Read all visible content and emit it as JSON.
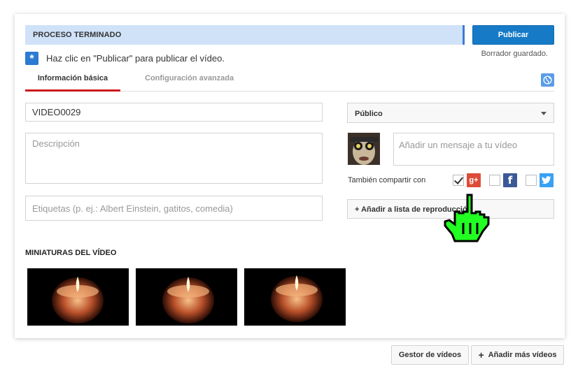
{
  "status": {
    "text": "PROCESO TERMINADO"
  },
  "actions": {
    "publish_label": "Publicar",
    "draft_status": "Borrador guardado."
  },
  "hint": {
    "icon": "asterisk-icon",
    "text": "Haz clic en \"Publicar\" para publicar el vídeo."
  },
  "tabs": [
    {
      "label": "Información básica",
      "active": true
    },
    {
      "label": "Configuración avanzada",
      "active": false
    }
  ],
  "form": {
    "title_value": "VIDEO0029",
    "description_placeholder": "Descripción",
    "tags_placeholder": "Etiquetas (p. ej.: Albert Einstein, gatitos, comedia)"
  },
  "privacy": {
    "selected": "Público"
  },
  "share": {
    "message_placeholder": "Añadir un mensaje a tu vídeo",
    "label": "También compartir con",
    "networks": [
      {
        "name": "google-plus",
        "checked": true,
        "color": "#dd4b39"
      },
      {
        "name": "facebook",
        "checked": false,
        "color": "#3b5998"
      },
      {
        "name": "twitter",
        "checked": false,
        "color": "#38a1f3"
      }
    ]
  },
  "playlist": {
    "label": "+ Añadir a lista de reproducción"
  },
  "thumbnails": {
    "heading": "MINIATURAS DEL VÍDEO"
  },
  "footer": {
    "manager_label": "Gestor de vídeos",
    "more_label": "Añadir más vídeos"
  },
  "colors": {
    "accent": "#167ac6",
    "status_bg": "#cfe2f8",
    "active_tab": "#cc181e",
    "cursor": "#22ff22"
  }
}
